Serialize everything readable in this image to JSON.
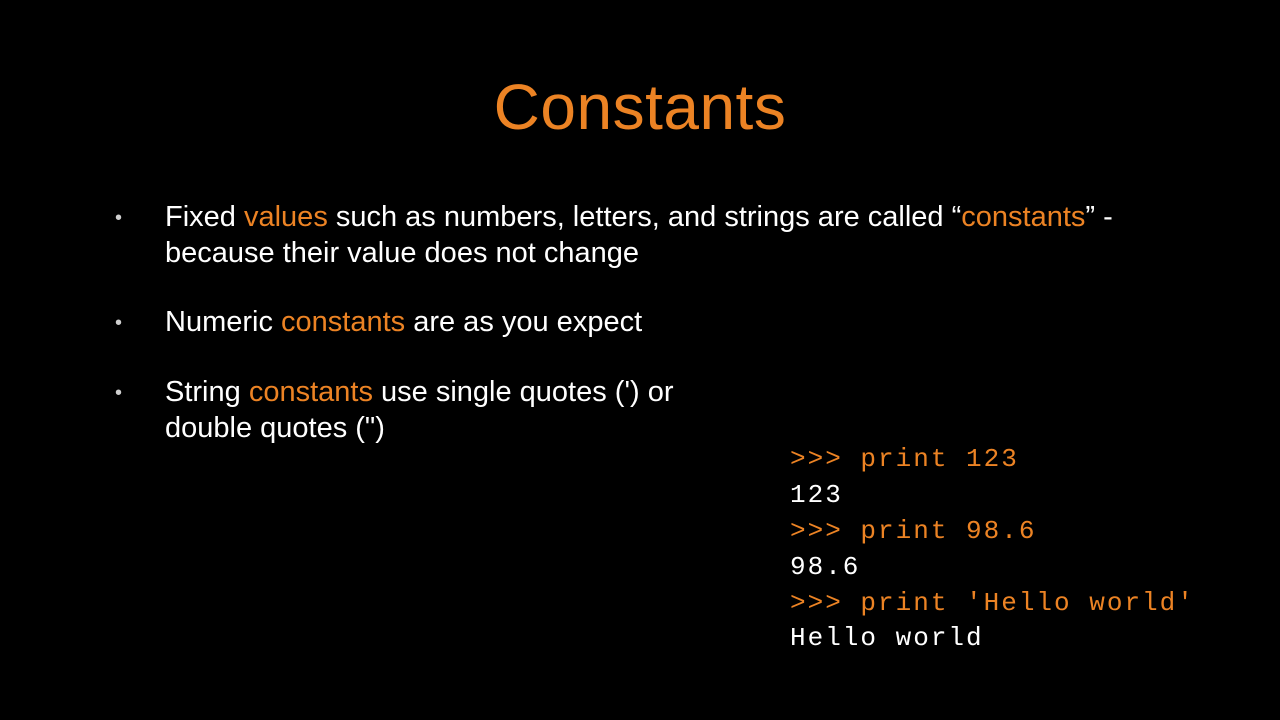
{
  "title": "Constants",
  "bullets": {
    "b1_pre": "Fixed ",
    "b1_hl1": "values",
    "b1_mid": " such as numbers, letters, and strings are called “",
    "b1_hl2": "constants",
    "b1_post": "” - because their value does not change",
    "b2_pre": "Numeric ",
    "b2_hl": "constants",
    "b2_post": " are as you expect",
    "b3_pre": "String ",
    "b3_hl": "constants",
    "b3_post": " use single quotes (') or double quotes (\")"
  },
  "code": {
    "l1": ">>> print 123",
    "l2": "123",
    "l3": ">>> print 98.6",
    "l4": "98.6",
    "l5": ">>> print 'Hello world'",
    "l6": "Hello world"
  }
}
